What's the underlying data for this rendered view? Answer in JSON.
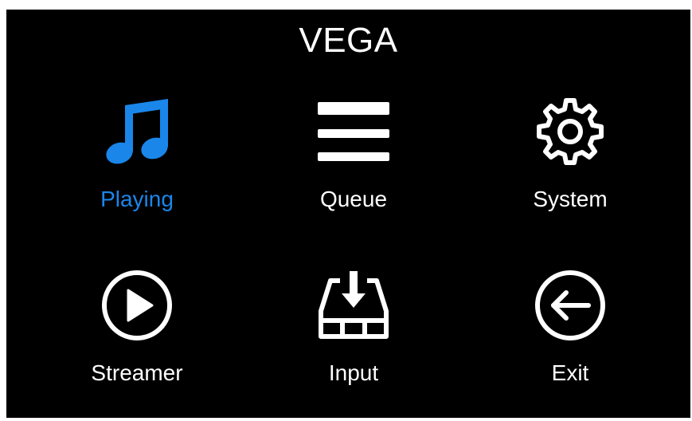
{
  "app": {
    "title": "VEGA"
  },
  "colors": {
    "background": "#000000",
    "foreground": "#ffffff",
    "selected": "#1a86ea"
  },
  "menu": {
    "selected_index": 0,
    "items": [
      {
        "label": "Playing",
        "icon": "music-note-icon"
      },
      {
        "label": "Queue",
        "icon": "list-icon"
      },
      {
        "label": "System",
        "icon": "gear-icon"
      },
      {
        "label": "Streamer",
        "icon": "play-circle-icon"
      },
      {
        "label": "Input",
        "icon": "input-tray-icon"
      },
      {
        "label": "Exit",
        "icon": "back-arrow-circle-icon"
      }
    ]
  }
}
